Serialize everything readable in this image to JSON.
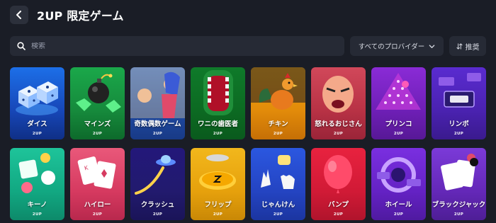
{
  "header": {
    "title": "2UP 限定ゲーム"
  },
  "search": {
    "placeholder": "検索"
  },
  "provider": {
    "label": "すべてのプロバイダー"
  },
  "sort": {
    "label": "推奨"
  },
  "games": [
    {
      "name": "ダイス",
      "badge": "2UP",
      "bg": "linear-gradient(180deg,#1c6fe8 0%,#1747b8 60%,#0f2f86 100%)"
    },
    {
      "name": "マインズ",
      "badge": "2UP",
      "bg": "linear-gradient(180deg,#1aa84a 0%,#168a3c 60%,#0d6a2b 100%)"
    },
    {
      "name": "奇数偶数ゲーム",
      "badge": "2UP",
      "bg": "linear-gradient(180deg,#2f66c8 0%,#1f4aa3 60%,#183a86 100%)"
    },
    {
      "name": "ワニの歯医者",
      "badge": "2UP",
      "bg": "linear-gradient(180deg,#0f7a2a 0%,#0c6a22 60%,#0a5a1d 100%)"
    },
    {
      "name": "チキン",
      "badge": "2UP",
      "bg": "linear-gradient(180deg,#f0a50c 0%,#e28b0a 60%,#c56f06 100%)"
    },
    {
      "name": "怒れるおじさん",
      "badge": "2UP",
      "bg": "linear-gradient(180deg,#d1485a 0%,#b83245 60%,#9a2438 100%)"
    },
    {
      "name": "プリンコ",
      "badge": "2UP",
      "bg": "linear-gradient(180deg,#8a2bd6 0%,#6e1fb6 60%,#571896 100%)"
    },
    {
      "name": "リンボ",
      "badge": "2UP",
      "bg": "linear-gradient(180deg,#5a2bd0 0%,#4a22b0 60%,#3a1a8e 100%)"
    },
    {
      "name": "キーノ",
      "badge": "2UP",
      "bg": "linear-gradient(180deg,#1ec49a 0%,#12a882 60%,#0d8a6a 100%)"
    },
    {
      "name": "ハイロー",
      "badge": "2UP",
      "bg": "linear-gradient(180deg,#e9587a 0%,#d63a60 60%,#b8284d 100%)"
    },
    {
      "name": "クラッシュ",
      "badge": "2UP",
      "bg": "linear-gradient(180deg,#23187a 0%,#221a6e 60%,#1a1458 100%)"
    },
    {
      "name": "フリップ",
      "badge": "2UP",
      "bg": "linear-gradient(180deg,#f2b71c 0%,#e6a10c 60%,#c98806 100%)"
    },
    {
      "name": "じゃんけん",
      "badge": "2UP",
      "bg": "linear-gradient(180deg,#2b57e0 0%,#2444c2 60%,#1b35a0 100%)"
    },
    {
      "name": "バンプ",
      "badge": "2UP",
      "bg": "linear-gradient(180deg,#e8223f 0%,#d11a36 60%,#b0142c 100%)"
    },
    {
      "name": "ホイール",
      "badge": "2UP",
      "bg": "linear-gradient(180deg,#7a2fe0 0%,#6422c4 60%,#4f1aa0 100%)"
    },
    {
      "name": "ブラックジャック",
      "badge": "2UP",
      "bg": "linear-gradient(180deg,#7b3ad8 0%,#6428b8 60%,#4e1e96 100%)"
    }
  ]
}
